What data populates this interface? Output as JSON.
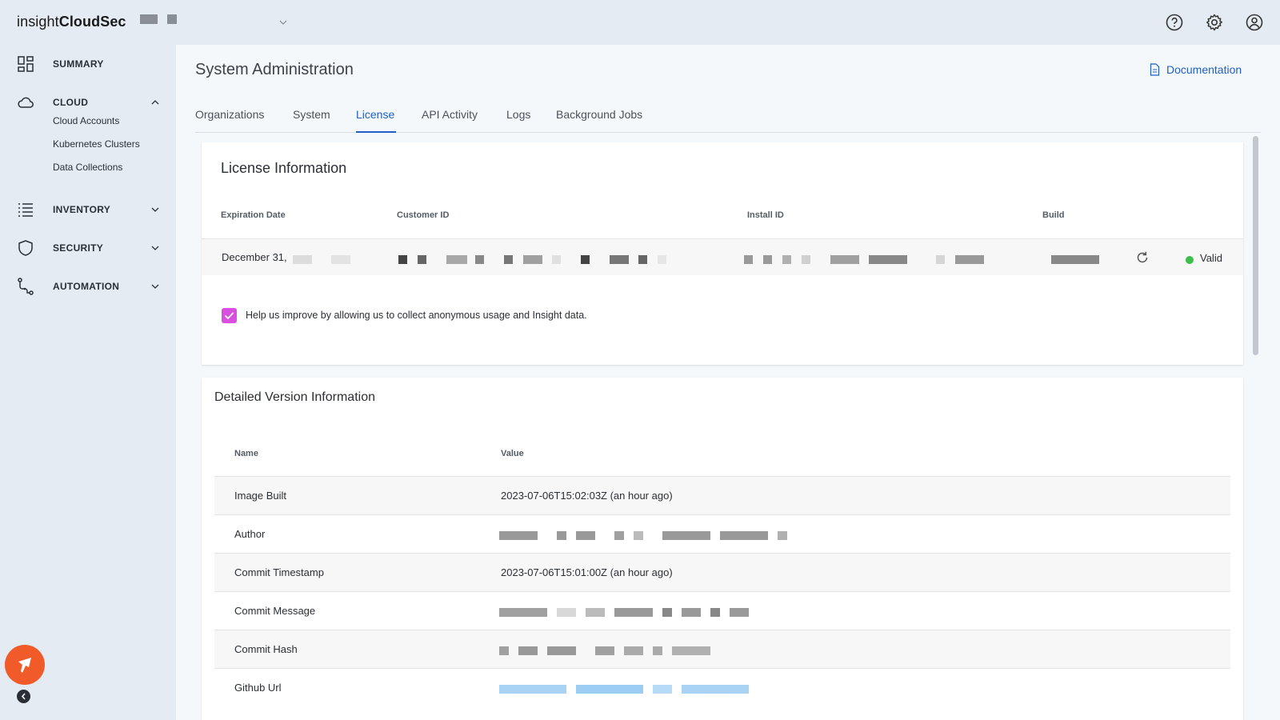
{
  "app": {
    "logo_light": "insight",
    "logo_bold": "CloudSec"
  },
  "icons": {
    "help": "help-circle-icon",
    "settings": "gear-icon",
    "account": "user-circle-icon",
    "summary": "grid-icon",
    "cloud": "cloud-icon",
    "inventory": "list-icon",
    "security": "shield-icon",
    "automation": "workflow-icon",
    "documentation": "document-icon",
    "refresh": "refresh-icon"
  },
  "sidebar": {
    "summary": "SUMMARY",
    "cloud": "CLOUD",
    "cloud_items": [
      "Cloud Accounts",
      "Kubernetes Clusters",
      "Data Collections"
    ],
    "inventory": "INVENTORY",
    "security": "SECURITY",
    "automation": "AUTOMATION"
  },
  "page": {
    "title": "System Administration",
    "documentation": "Documentation"
  },
  "tabs": [
    "Organizations",
    "System",
    "License",
    "API Activity",
    "Logs",
    "Background Jobs"
  ],
  "active_tab": "License",
  "license": {
    "title": "License Information",
    "columns": [
      "Expiration Date",
      "Customer ID",
      "Install ID",
      "Build"
    ],
    "expiration_prefix": "December 31,",
    "status": "Valid",
    "consent_label": "Help us improve by allowing us to collect anonymous usage and Insight data.",
    "consent_checked": true
  },
  "version": {
    "title": "Detailed Version Information",
    "columns": [
      "Name",
      "Value"
    ],
    "rows": [
      {
        "name": "Image Built",
        "value": "2023-07-06T15:02:03Z (an hour ago)"
      },
      {
        "name": "Author",
        "value": ""
      },
      {
        "name": "Commit Timestamp",
        "value": "2023-07-06T15:01:00Z (an hour ago)"
      },
      {
        "name": "Commit Message",
        "value": ""
      },
      {
        "name": "Commit Hash",
        "value": ""
      },
      {
        "name": "Github Url",
        "value": ""
      }
    ]
  },
  "colors": {
    "accent": "#1f5fc7",
    "checkbox": "#d94fe0",
    "valid": "#3dbd4a",
    "fab": "#f15a29",
    "chrome": "#e4ebf2"
  }
}
